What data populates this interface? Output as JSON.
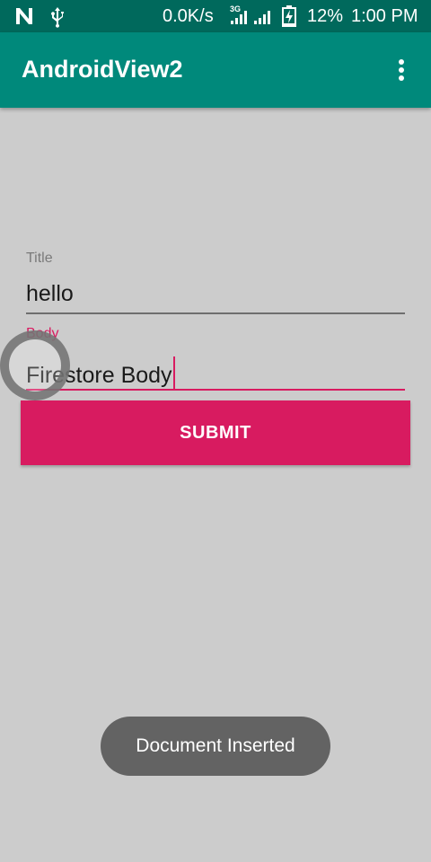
{
  "status_bar": {
    "icons": [
      "n-notification-icon",
      "usb-icon",
      "signal-3g-icon",
      "signal-icon",
      "battery-charging-icon"
    ],
    "net_speed": "0.0K/s",
    "network_type": "3G",
    "battery_percent": "12%",
    "time": "1:00 PM"
  },
  "app_bar": {
    "title": "AndroidView2",
    "menu_icon": "overflow-menu-icon"
  },
  "form": {
    "title_label": "Title",
    "title_value": "hello",
    "body_label": "Body",
    "body_value": "Firestore Body"
  },
  "submit_label": "SUBMIT",
  "toast": "Document Inserted",
  "colors": {
    "status_bar": "#00695c",
    "app_bar": "#00897b",
    "accent": "#d81b60",
    "background": "#cccccc",
    "toast": "#636363"
  }
}
